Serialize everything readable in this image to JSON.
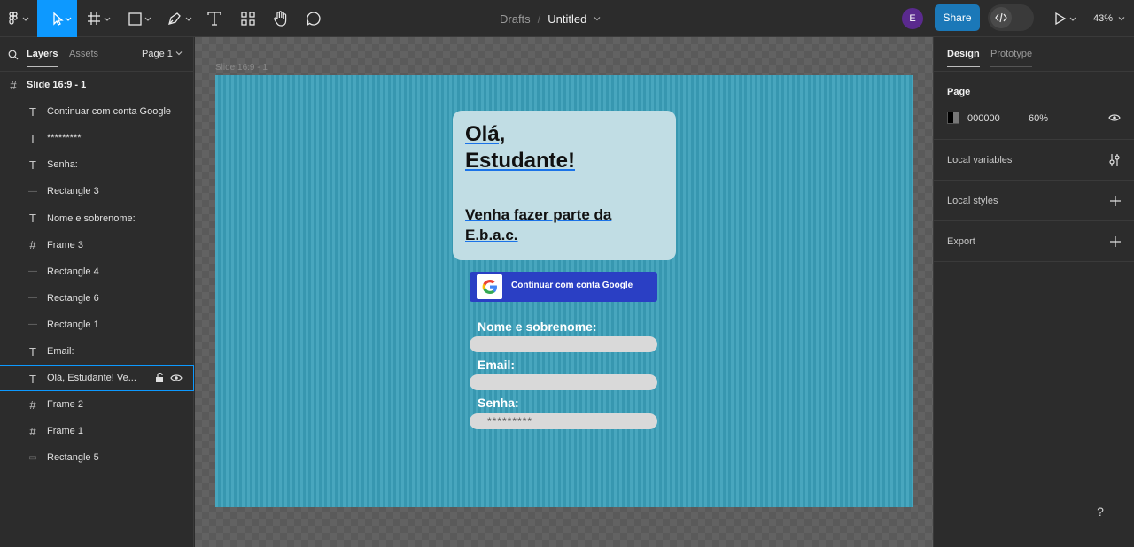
{
  "toolbar": {
    "title_drafts": "Drafts",
    "title_separator": "/",
    "file_name": "Untitled",
    "avatar_initial": "E",
    "share_label": "Share",
    "zoom_label": "43%",
    "tools": [
      "figma-menu-icon",
      "move-tool-icon",
      "frame-tool-icon",
      "shape-tool-icon",
      "pen-tool-icon",
      "text-tool-icon",
      "resources-icon",
      "hand-tool-icon",
      "comment-icon"
    ]
  },
  "left_panel": {
    "tab_layers": "Layers",
    "tab_assets": "Assets",
    "page_selector": "Page 1",
    "layers": [
      {
        "icon": "#",
        "name": "Slide 16:9 - 1",
        "type": "frame",
        "top": true
      },
      {
        "icon": "T",
        "name": "Continuar com conta Google",
        "type": "text"
      },
      {
        "icon": "T",
        "name": "*********",
        "type": "text"
      },
      {
        "icon": "T",
        "name": "Senha:",
        "type": "text"
      },
      {
        "icon": "—",
        "name": "Rectangle 3",
        "type": "rectangle"
      },
      {
        "icon": "T",
        "name": "Nome e sobrenome:",
        "type": "text"
      },
      {
        "icon": "#",
        "name": "Frame 3",
        "type": "frame"
      },
      {
        "icon": "—",
        "name": "Rectangle 4",
        "type": "rectangle"
      },
      {
        "icon": "—",
        "name": "Rectangle 6",
        "type": "rectangle"
      },
      {
        "icon": "—",
        "name": "Rectangle 1",
        "type": "rectangle"
      },
      {
        "icon": "T",
        "name": "Email:",
        "type": "text"
      },
      {
        "icon": "T",
        "name": "Olá, Estudante! Ve...",
        "type": "text",
        "selected": true
      },
      {
        "icon": "#",
        "name": "Frame 2",
        "type": "frame"
      },
      {
        "icon": "#",
        "name": "Frame 1",
        "type": "frame"
      },
      {
        "icon": "▭",
        "name": "Rectangle 5",
        "type": "rectangle"
      }
    ]
  },
  "canvas": {
    "frame_label": "Slide 16:9 - 1",
    "card": {
      "greeting_line1": "Olá,",
      "greeting_line2": "Estudante!",
      "invite_line1": "Venha fazer  parte da",
      "invite_line2": "E.b.a.c."
    },
    "google_button_label": "Continuar com conta Google",
    "name_label": "Nome e sobrenome:",
    "email_label": "Email:",
    "password_label": "Senha:",
    "password_value": "*********",
    "slide_color": "#3a9fb9",
    "card_color": "#c1dde4",
    "button_color": "#2a3fc4"
  },
  "right_panel": {
    "tab_design": "Design",
    "tab_prototype": "Prototype",
    "page_section_title": "Page",
    "page_color_hex": "000000",
    "page_opacity": "60%",
    "local_variables": "Local variables",
    "local_styles": "Local styles",
    "export": "Export"
  },
  "help_label": "?"
}
